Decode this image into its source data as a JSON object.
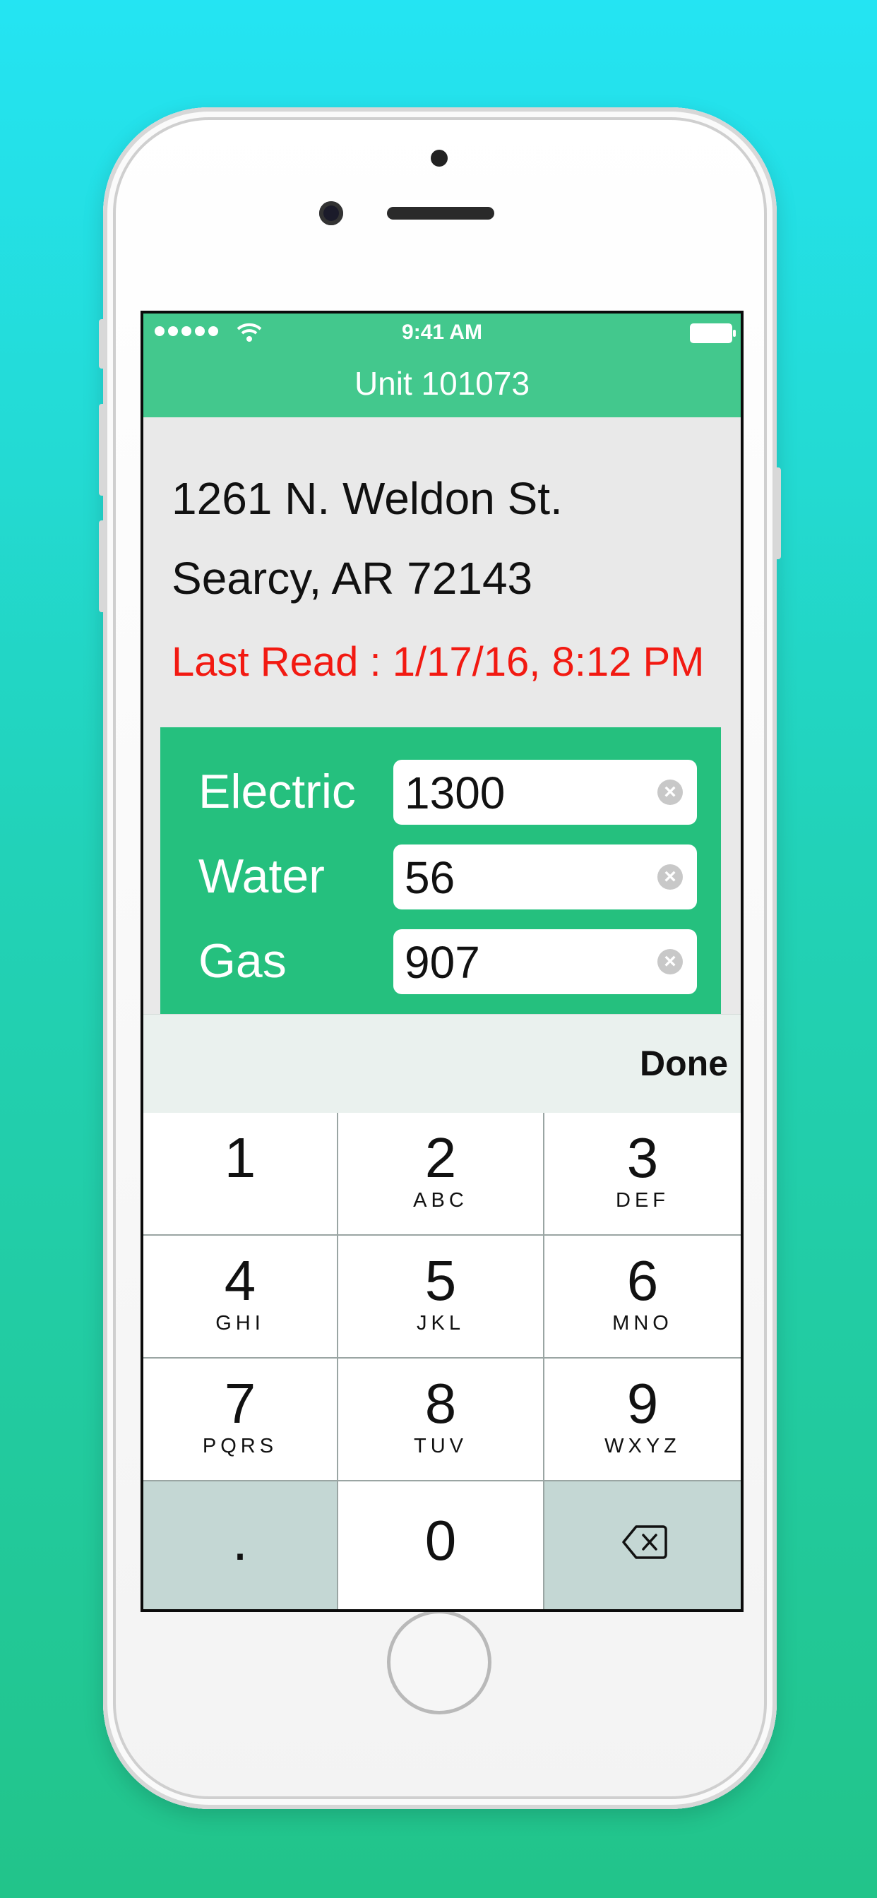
{
  "status_bar": {
    "time": "9:41 AM"
  },
  "nav": {
    "title": "Unit 101073"
  },
  "address": {
    "line1": "1261 N. Weldon St.",
    "line2": "Searcy, AR 72143"
  },
  "last_read": "Last Read : 1/17/16, 8:12 PM",
  "readings": [
    {
      "label": "Electric",
      "value": "1300"
    },
    {
      "label": "Water",
      "value": "56"
    },
    {
      "label": "Gas",
      "value": "907"
    }
  ],
  "toolbar": {
    "done_label": "Done"
  },
  "keypad": {
    "keys": [
      {
        "num": "1",
        "letters": ""
      },
      {
        "num": "2",
        "letters": "ABC"
      },
      {
        "num": "3",
        "letters": "DEF"
      },
      {
        "num": "4",
        "letters": "GHI"
      },
      {
        "num": "5",
        "letters": "JKL"
      },
      {
        "num": "6",
        "letters": "MNO"
      },
      {
        "num": "7",
        "letters": "PQRS"
      },
      {
        "num": "8",
        "letters": "TUV"
      },
      {
        "num": "9",
        "letters": "WXYZ"
      },
      {
        "num": ".",
        "letters": ""
      },
      {
        "num": "0",
        "letters": ""
      }
    ]
  },
  "colors": {
    "accent": "#43c88d",
    "panel": "#25c07e",
    "alert": "#f21a12"
  }
}
